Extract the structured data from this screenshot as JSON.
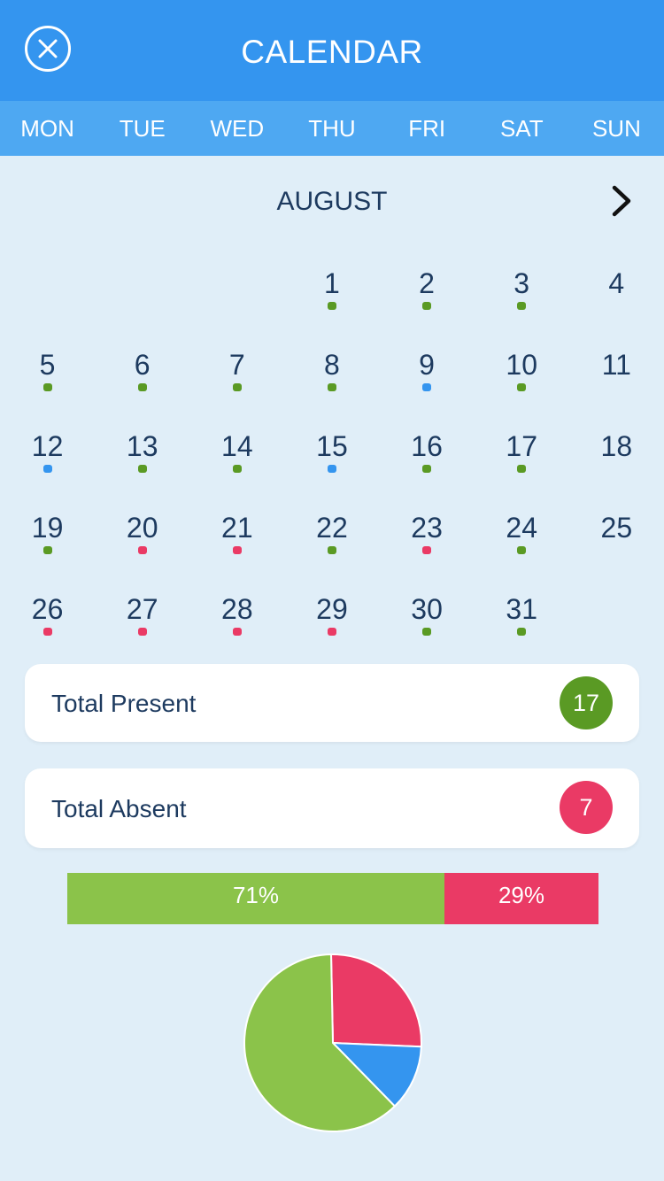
{
  "header": {
    "title": "CALENDAR",
    "close_icon": "close-icon"
  },
  "weekdays": [
    "MON",
    "TUE",
    "WED",
    "THU",
    "FRI",
    "SAT",
    "SUN"
  ],
  "month": {
    "name": "AUGUST",
    "next_icon": "chevron-right-icon"
  },
  "colors": {
    "present": "#5a9a24",
    "absent": "#ea3a65",
    "holiday": "#3495ef",
    "present_light": "#8bc34a",
    "header": "#3495ef",
    "weekbar": "#4ea8f2"
  },
  "calendar": {
    "leading_blanks": 3,
    "days": [
      {
        "day": "1",
        "status": "present"
      },
      {
        "day": "2",
        "status": "present"
      },
      {
        "day": "3",
        "status": "present"
      },
      {
        "day": "4",
        "status": null
      },
      {
        "day": "5",
        "status": "present"
      },
      {
        "day": "6",
        "status": "present"
      },
      {
        "day": "7",
        "status": "present"
      },
      {
        "day": "8",
        "status": "present"
      },
      {
        "day": "9",
        "status": "holiday"
      },
      {
        "day": "10",
        "status": "present"
      },
      {
        "day": "11",
        "status": null
      },
      {
        "day": "12",
        "status": "holiday"
      },
      {
        "day": "13",
        "status": "present"
      },
      {
        "day": "14",
        "status": "present"
      },
      {
        "day": "15",
        "status": "holiday"
      },
      {
        "day": "16",
        "status": "present"
      },
      {
        "day": "17",
        "status": "present"
      },
      {
        "day": "18",
        "status": null
      },
      {
        "day": "19",
        "status": "present"
      },
      {
        "day": "20",
        "status": "absent"
      },
      {
        "day": "21",
        "status": "absent"
      },
      {
        "day": "22",
        "status": "present"
      },
      {
        "day": "23",
        "status": "absent"
      },
      {
        "day": "24",
        "status": "present"
      },
      {
        "day": "25",
        "status": null
      },
      {
        "day": "26",
        "status": "absent"
      },
      {
        "day": "27",
        "status": "absent"
      },
      {
        "day": "28",
        "status": "absent"
      },
      {
        "day": "29",
        "status": "absent"
      },
      {
        "day": "30",
        "status": "present"
      },
      {
        "day": "31",
        "status": "present"
      }
    ]
  },
  "summary": {
    "present_label": "Total Present",
    "present_count": "17",
    "absent_label": "Total Absent",
    "absent_count": "7"
  },
  "progress": {
    "present_label": "71%",
    "present_value": 71,
    "absent_label": "29%",
    "absent_value": 29
  },
  "pie": [
    {
      "key": "absent",
      "fraction": 0.26
    },
    {
      "key": "holiday",
      "fraction": 0.12
    },
    {
      "key": "present",
      "fraction": 0.62
    }
  ]
}
